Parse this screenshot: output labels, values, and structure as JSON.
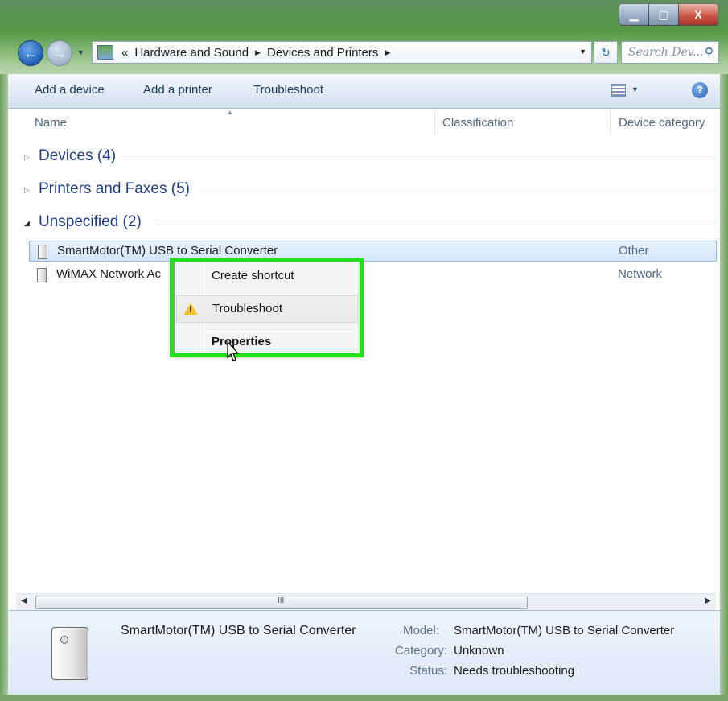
{
  "window": {
    "minimize_label": "▁",
    "maximize_label": "▢",
    "close_label": "X"
  },
  "address": {
    "overflow": "«",
    "crumbs": [
      "Hardware and Sound",
      "Devices and Printers"
    ]
  },
  "search": {
    "placeholder": "Search Dev..."
  },
  "toolbar": {
    "add_device": "Add a device",
    "add_printer": "Add a printer",
    "troubleshoot": "Troubleshoot"
  },
  "columns": [
    "Name",
    "Classification",
    "Device category"
  ],
  "groups": [
    {
      "title": "Devices (4)",
      "expanded": false
    },
    {
      "title": "Printers and Faxes (5)",
      "expanded": false
    },
    {
      "title": "Unspecified (2)",
      "expanded": true
    }
  ],
  "rows": [
    {
      "name": "SmartMotor(TM) USB to Serial Converter",
      "category": "Other",
      "selected": true
    },
    {
      "name": "WiMAX Network Ac",
      "category": "Network",
      "selected": false
    }
  ],
  "context_menu": {
    "items": [
      "Create shortcut",
      "Troubleshoot",
      "Properties"
    ],
    "highlight_color": "#1fe21b"
  },
  "scrollbar": {
    "grip": "III"
  },
  "details": {
    "name": "SmartMotor(TM) USB to Serial Converter",
    "model_label": "Model:",
    "model_value": "SmartMotor(TM) USB to Serial Converter",
    "category_label": "Category:",
    "category_value": "Unknown",
    "status_label": "Status:",
    "status_value": "Needs troubleshooting"
  }
}
